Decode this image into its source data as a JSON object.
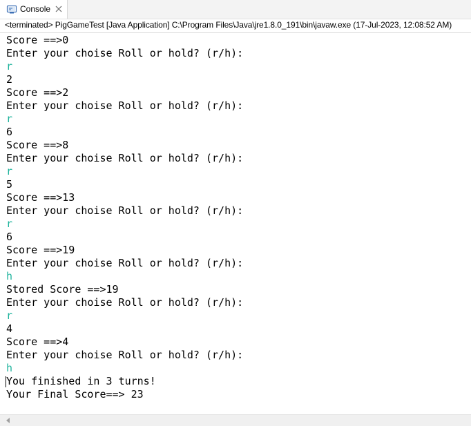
{
  "tab": {
    "label": "Console",
    "icon": "console-icon",
    "close_icon": "close-icon"
  },
  "status": "<terminated> PigGameTest [Java Application] C:\\Program Files\\Java\\jre1.8.0_191\\bin\\javaw.exe (17-Jul-2023, 12:08:52 AM)",
  "console": {
    "input_color": "#1eb39c",
    "output_color": "#000000",
    "lines": [
      {
        "text": "Score ==>0",
        "type": "output"
      },
      {
        "text": "Enter your choise Roll or hold? (r/h):",
        "type": "output"
      },
      {
        "text": "r",
        "type": "input"
      },
      {
        "text": "2",
        "type": "output"
      },
      {
        "text": "Score ==>2",
        "type": "output"
      },
      {
        "text": "Enter your choise Roll or hold? (r/h):",
        "type": "output"
      },
      {
        "text": "r",
        "type": "input"
      },
      {
        "text": "6",
        "type": "output"
      },
      {
        "text": "Score ==>8",
        "type": "output"
      },
      {
        "text": "Enter your choise Roll or hold? (r/h):",
        "type": "output"
      },
      {
        "text": "r",
        "type": "input"
      },
      {
        "text": "5",
        "type": "output"
      },
      {
        "text": "Score ==>13",
        "type": "output"
      },
      {
        "text": "Enter your choise Roll or hold? (r/h):",
        "type": "output"
      },
      {
        "text": "r",
        "type": "input"
      },
      {
        "text": "6",
        "type": "output"
      },
      {
        "text": "Score ==>19",
        "type": "output"
      },
      {
        "text": "Enter your choise Roll or hold? (r/h):",
        "type": "output"
      },
      {
        "text": "h",
        "type": "input"
      },
      {
        "text": "Stored Score ==>19",
        "type": "output"
      },
      {
        "text": "Enter your choise Roll or hold? (r/h):",
        "type": "output"
      },
      {
        "text": "r",
        "type": "input"
      },
      {
        "text": "4",
        "type": "output"
      },
      {
        "text": "Score ==>4",
        "type": "output"
      },
      {
        "text": "Enter your choise Roll or hold? (r/h):",
        "type": "output"
      },
      {
        "text": "h",
        "type": "input"
      },
      {
        "text": "You finished in 3 turns!",
        "type": "output"
      },
      {
        "text": "Your Final Score==> 23",
        "type": "output"
      }
    ]
  }
}
